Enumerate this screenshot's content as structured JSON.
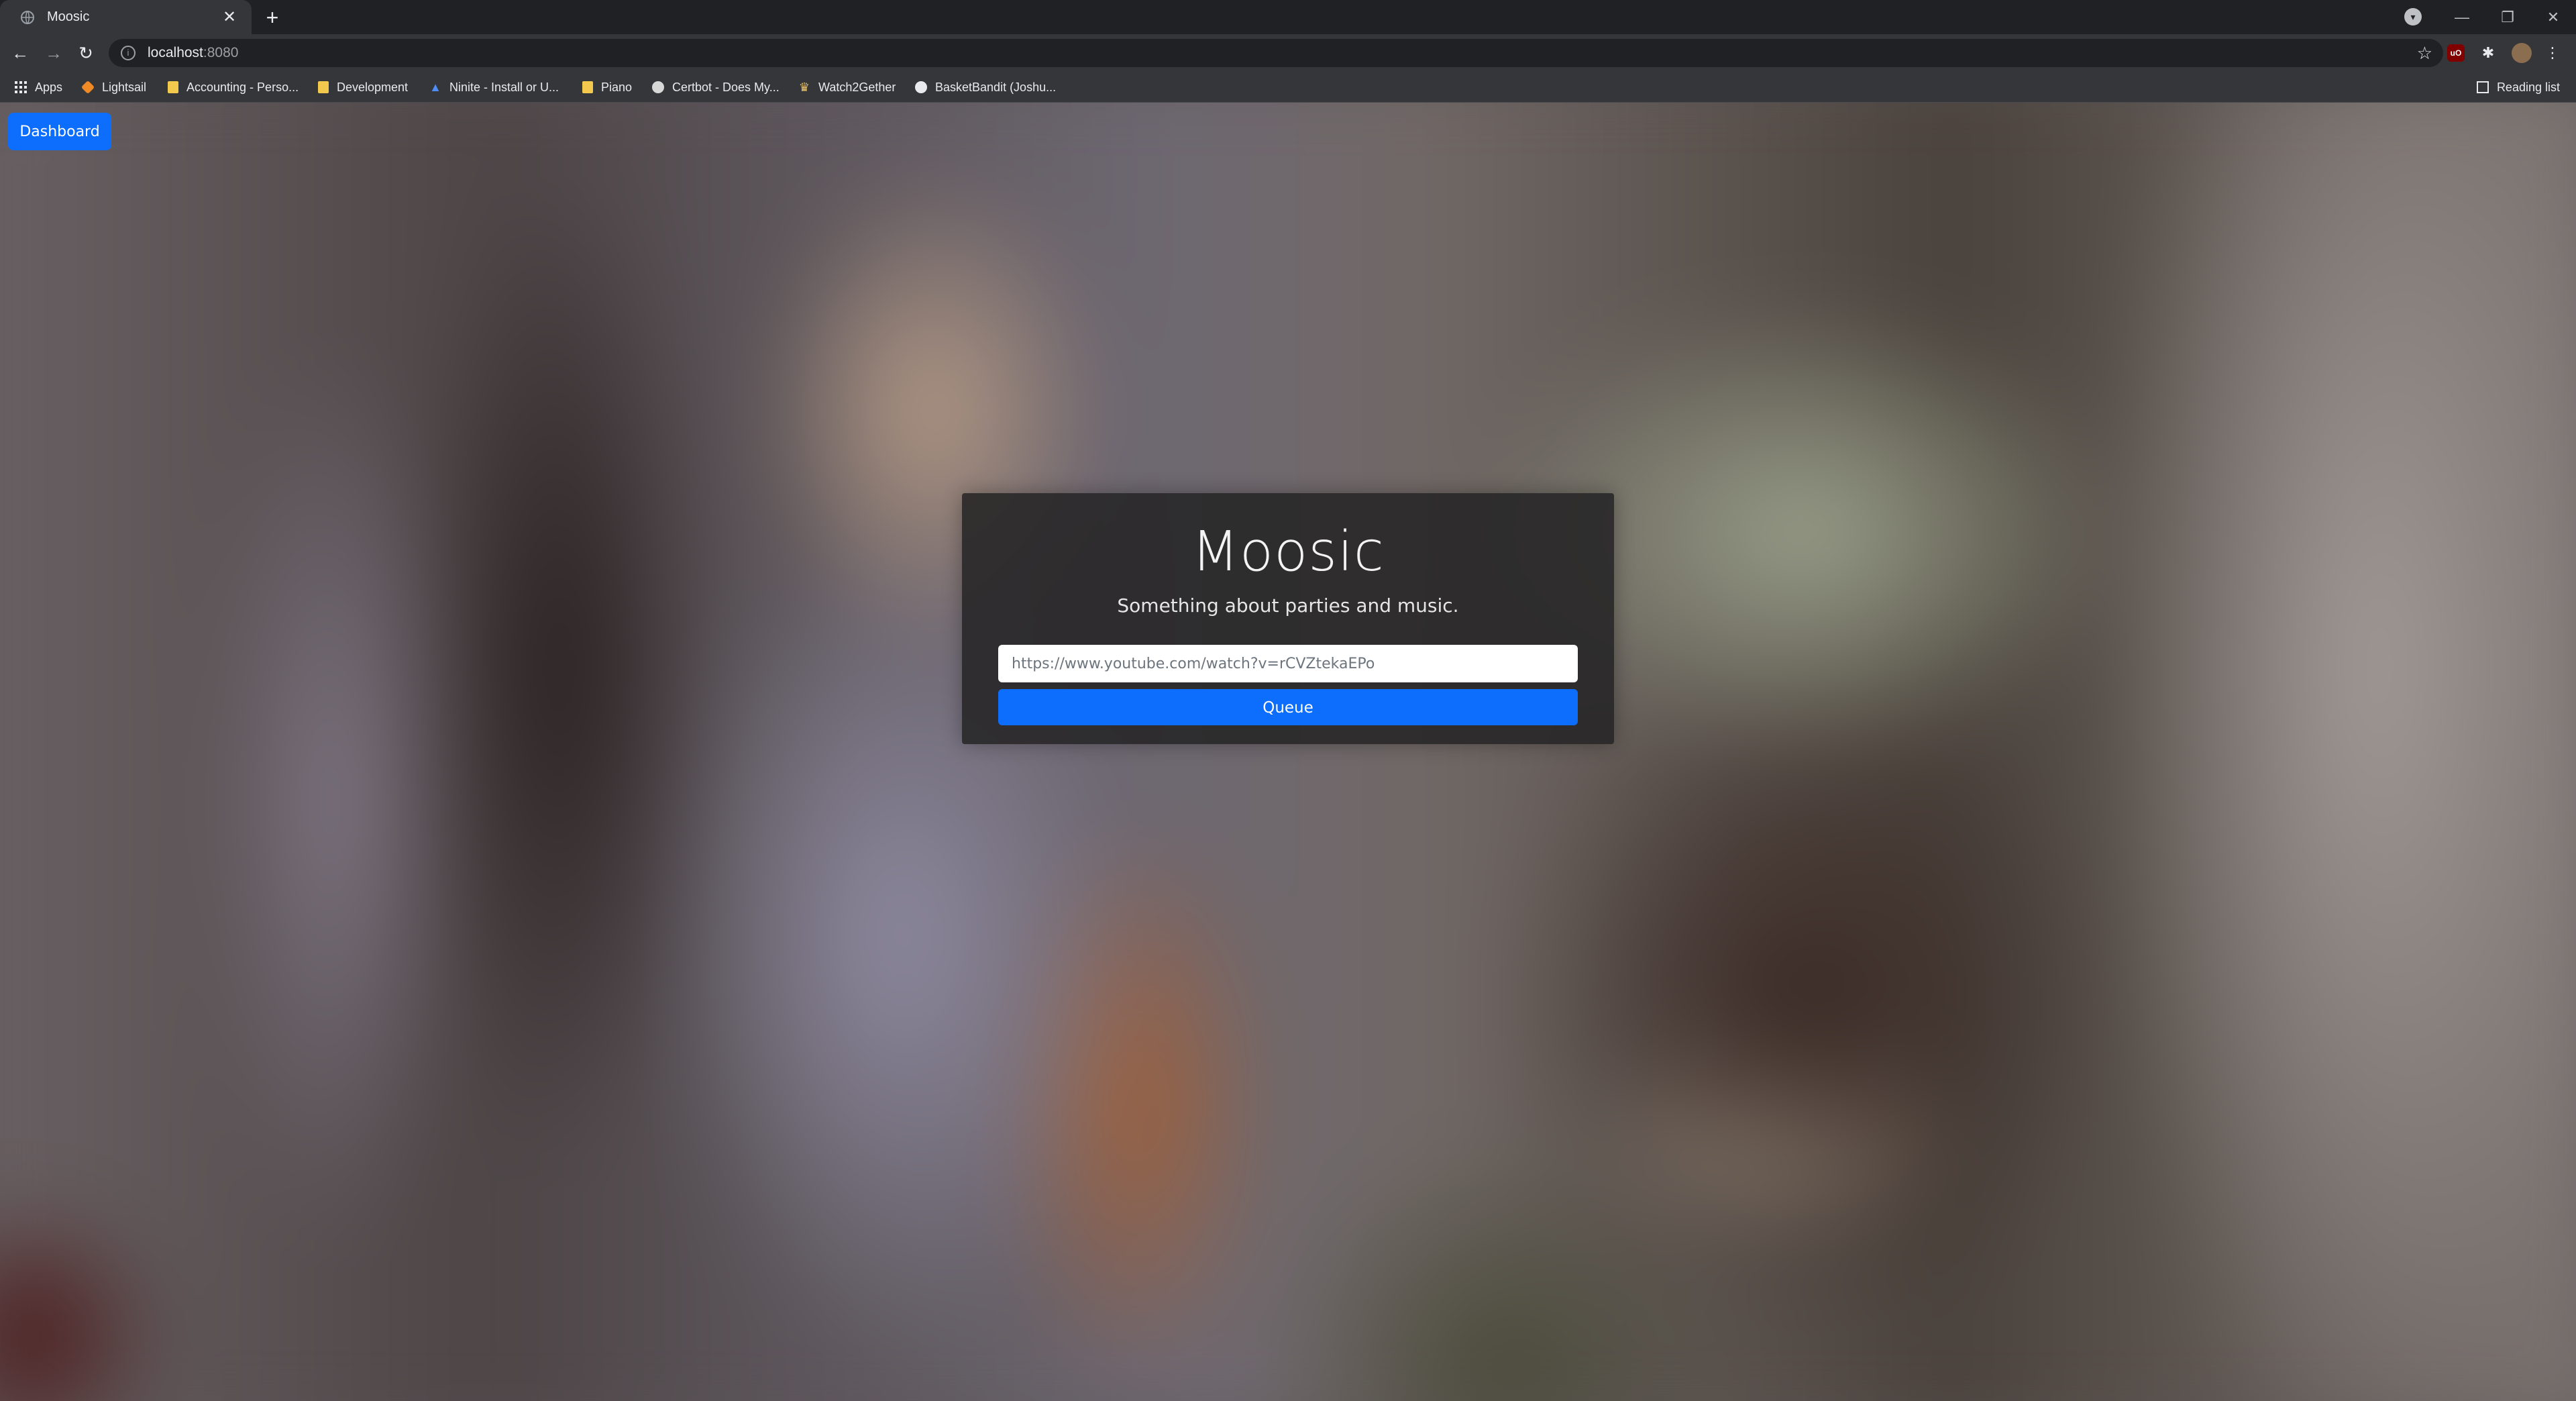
{
  "browser": {
    "tab_title": "Moosic",
    "new_tab_symbol": "+",
    "url_host": "localhost",
    "url_port": ":8080",
    "bookmarks": [
      {
        "label": "Apps",
        "icon": "apps-grid-icon"
      },
      {
        "label": "Lightsail",
        "icon": "lightsail-cube-icon"
      },
      {
        "label": "Accounting - Perso...",
        "icon": "folder-icon"
      },
      {
        "label": "Development",
        "icon": "folder-icon"
      },
      {
        "label": "Ninite - Install or U...",
        "icon": "ninite-icon"
      },
      {
        "label": "Piano",
        "icon": "folder-icon"
      },
      {
        "label": "Certbot - Does My...",
        "icon": "certbot-icon"
      },
      {
        "label": "Watch2Gether",
        "icon": "watch2gether-icon"
      },
      {
        "label": "BasketBandit (Joshu...",
        "icon": "github-icon"
      }
    ],
    "reading_list": "Reading list"
  },
  "page": {
    "dashboard_label": "Dashboard",
    "title": "Moosic",
    "subtitle": "Something about parties and music.",
    "url_placeholder": "https://www.youtube.com/watch?v=rCVZtekaEPo",
    "queue_label": "Queue"
  },
  "colors": {
    "primary": "#0d6efd",
    "card_bg": "#262425",
    "chrome_dark": "#202124",
    "chrome_toolbar": "#35363a"
  }
}
